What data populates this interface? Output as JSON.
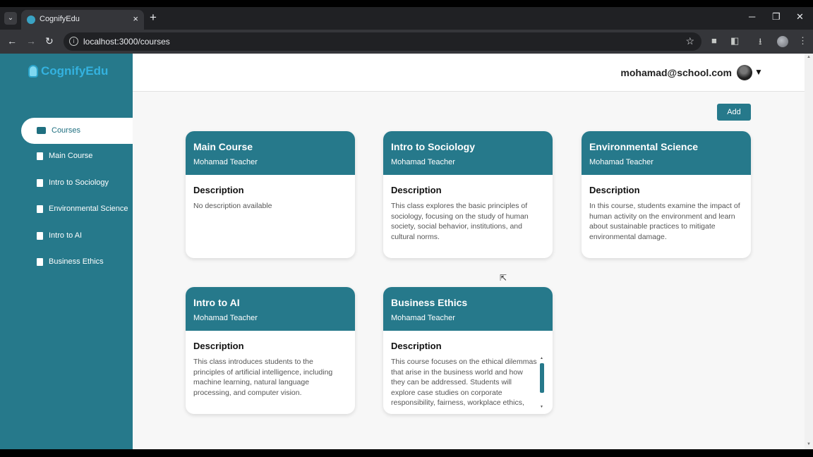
{
  "browser": {
    "tab_title": "CognifyEdu",
    "url": "localhost:3000/courses",
    "tab_close": "×",
    "new_tab": "+",
    "minimize": "─",
    "restore": "❐",
    "close": "✕",
    "back": "←",
    "forward": "→",
    "reload": "↻",
    "star": "☆",
    "menu": "⋮"
  },
  "sidebar": {
    "logo_text": "CognifyEdu",
    "active_item": "Courses",
    "items": [
      {
        "label": "Main Course"
      },
      {
        "label": "Intro to Sociology"
      },
      {
        "label": "Environmental Science"
      },
      {
        "label": "Intro to AI"
      },
      {
        "label": "Business Ethics"
      }
    ]
  },
  "header": {
    "email": "mohamad@school.com",
    "caret": "▼"
  },
  "actions": {
    "add_label": "Add"
  },
  "courses": [
    {
      "title": "Main Course",
      "teacher": "Mohamad Teacher",
      "desc_label": "Description",
      "description": "No description available"
    },
    {
      "title": "Intro to Sociology",
      "teacher": "Mohamad Teacher",
      "desc_label": "Description",
      "description": "This class explores the basic principles of sociology, focusing on the study of human society, social behavior, institutions, and cultural norms."
    },
    {
      "title": "Environmental Science",
      "teacher": "Mohamad Teacher",
      "desc_label": "Description",
      "description": "In this course, students examine the impact of human activity on the environment and learn about sustainable practices to mitigate environmental damage."
    },
    {
      "title": "Intro to AI",
      "teacher": "Mohamad Teacher",
      "desc_label": "Description",
      "description": "This class introduces students to the principles of artificial intelligence, including machine learning, natural language processing, and computer vision."
    },
    {
      "title": "Business Ethics",
      "teacher": "Mohamad Teacher",
      "desc_label": "Description",
      "description": "This course focuses on the ethical dilemmas that arise in the business world and how they can be addressed. Students will explore case studies on corporate responsibility, fairness, workplace ethics,"
    }
  ],
  "colors": {
    "primary": "#26798b",
    "logo": "#34b2e0"
  }
}
